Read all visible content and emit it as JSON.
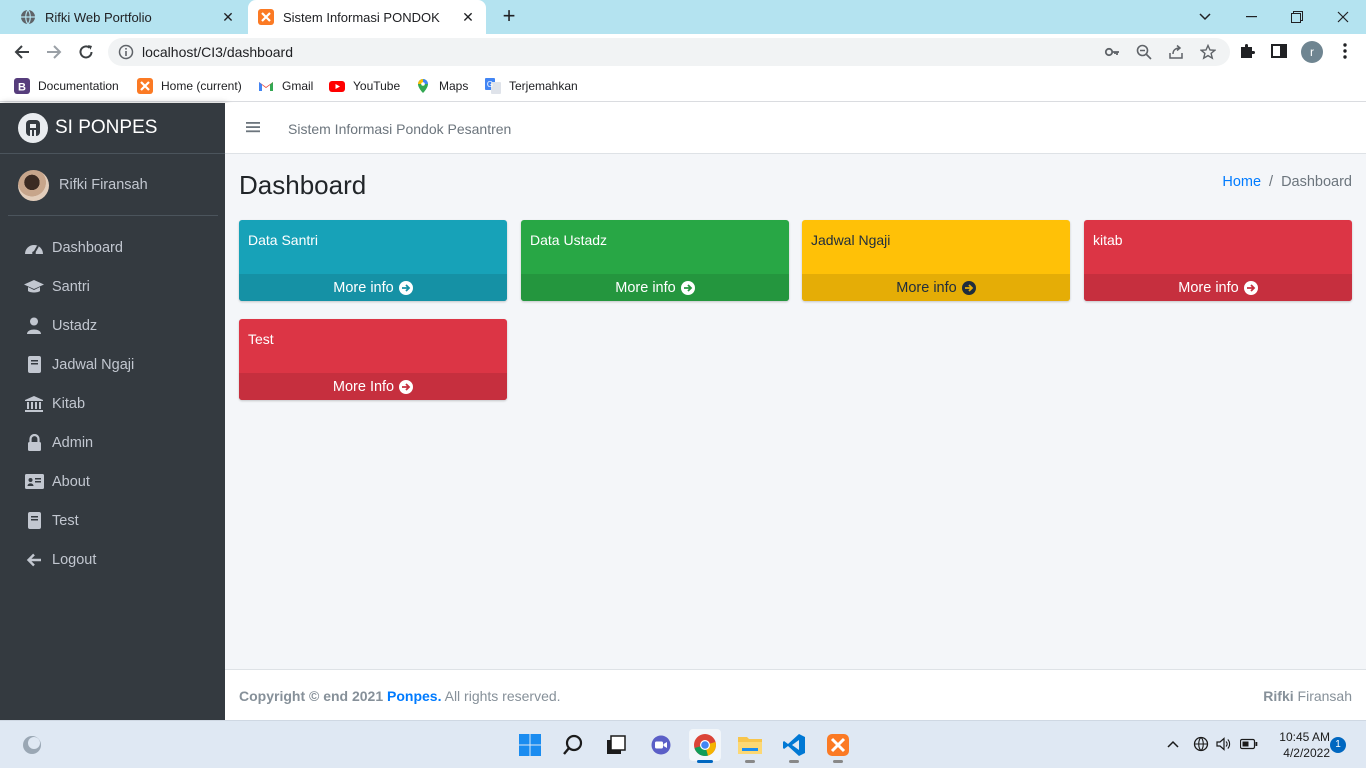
{
  "browser": {
    "tabs": [
      {
        "title": "Rifki Web Portfolio",
        "favicon": "globe-icon",
        "active": false
      },
      {
        "title": "Sistem Informasi PONDOK",
        "favicon": "xampp-icon",
        "active": true
      }
    ],
    "url": "localhost/CI3/dashboard",
    "profile_initial": "r",
    "bookmarks": [
      {
        "label": "Documentation",
        "icon": "bootstrap-icon"
      },
      {
        "label": "Home (current)",
        "icon": "xampp-icon"
      },
      {
        "label": "Gmail",
        "icon": "gmail-icon"
      },
      {
        "label": "YouTube",
        "icon": "youtube-icon"
      },
      {
        "label": "Maps",
        "icon": "maps-icon"
      },
      {
        "label": "Terjemahkan",
        "icon": "translate-icon"
      }
    ]
  },
  "sidebar": {
    "brand": "SI PONPES",
    "user": "Rifki Firansah",
    "items": [
      {
        "label": "Dashboard",
        "icon": "tachometer-icon"
      },
      {
        "label": "Santri",
        "icon": "graduation-cap-icon"
      },
      {
        "label": "Ustadz",
        "icon": "user-icon"
      },
      {
        "label": "Jadwal Ngaji",
        "icon": "book-icon"
      },
      {
        "label": "Kitab",
        "icon": "university-icon"
      },
      {
        "label": "Admin",
        "icon": "lock-icon"
      },
      {
        "label": "About",
        "icon": "id-card-icon"
      },
      {
        "label": "Test",
        "icon": "book-icon"
      },
      {
        "label": "Logout",
        "icon": "arrow-left-icon"
      }
    ]
  },
  "header": {
    "title": "Sistem Informasi Pondok Pesantren"
  },
  "content": {
    "page_title": "Dashboard",
    "breadcrumb": {
      "home": "Home",
      "separator": "/",
      "current": "Dashboard"
    },
    "boxes": [
      {
        "title": "Data Santri",
        "link": "More info",
        "color": "#17a2b8"
      },
      {
        "title": "Data Ustadz",
        "link": "More info",
        "color": "#28a745"
      },
      {
        "title": "Jadwal Ngaji",
        "link": "More info",
        "color": "#ffc107"
      },
      {
        "title": "kitab",
        "link": "More info",
        "color": "#dc3545"
      },
      {
        "title": "Test",
        "link": "More Info",
        "color": "#dc3545"
      }
    ]
  },
  "footer": {
    "copyright": "Copyright © end 2021",
    "brand": "Ponpes.",
    "rights": "All rights reserved.",
    "right_bold": "Rifki",
    "right_text": "Firansah"
  },
  "taskbar": {
    "time": "10:45 AM",
    "date": "4/2/2022",
    "notification_count": "1"
  }
}
